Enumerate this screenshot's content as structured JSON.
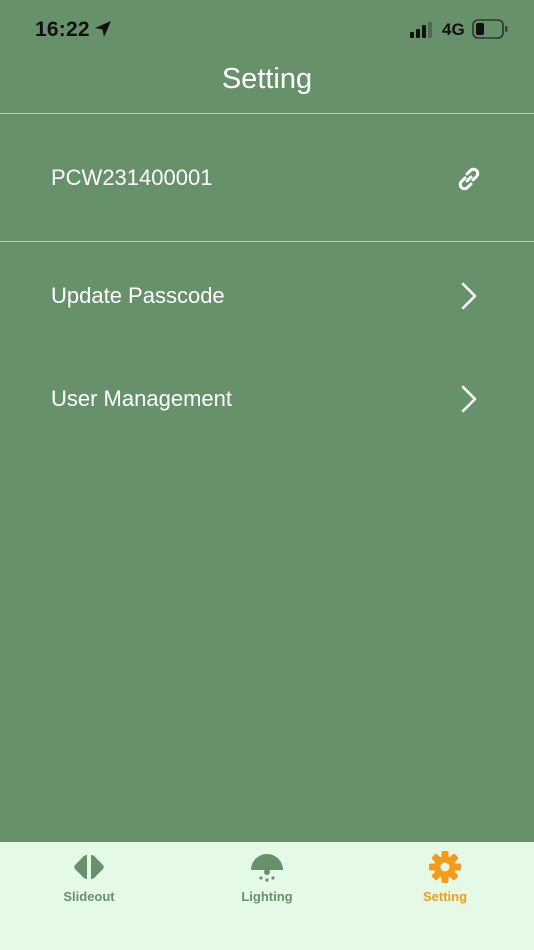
{
  "status_bar": {
    "time": "16:22",
    "network": "4G",
    "icons": [
      "location-arrow-icon",
      "cellular-signal-icon",
      "battery-icon"
    ]
  },
  "header": {
    "title": "Setting"
  },
  "device": {
    "id": "PCW231400001",
    "icon": "link-icon"
  },
  "menu": {
    "items": [
      {
        "label": "Update Passcode",
        "icon": "chevron-right-icon"
      },
      {
        "label": "User Management",
        "icon": "chevron-right-icon"
      }
    ]
  },
  "tab_bar": {
    "tabs": [
      {
        "label": "Slideout",
        "icon": "slideout-icon",
        "active": false
      },
      {
        "label": "Lighting",
        "icon": "lamp-icon",
        "active": false
      },
      {
        "label": "Setting",
        "icon": "gear-icon",
        "active": true
      }
    ]
  },
  "colors": {
    "background": "#66916b",
    "tab_bar_background": "#e4f9e6",
    "tab_inactive": "#66916b",
    "tab_active": "#f59b1c",
    "text": "#ffffff"
  }
}
